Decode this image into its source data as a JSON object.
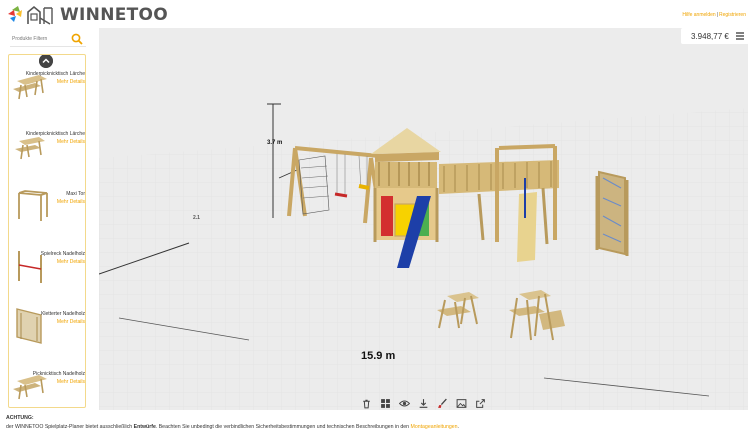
{
  "header": {
    "brand": "WINNETOO",
    "help_link": "Hilfe anmelden",
    "register_link": "Registrieren"
  },
  "sidebar": {
    "filter_placeholder": "Produkte Filtern",
    "products": [
      {
        "name": "Kinderpicknicktisch Lärche",
        "more": "Mehr Details"
      },
      {
        "name": "Kinderpicknicktisch Lärche",
        "more": "Mehr Details"
      },
      {
        "name": "Maxi Tor",
        "more": "Mehr Details"
      },
      {
        "name": "Spielreck Nadelholz",
        "more": "Mehr Details"
      },
      {
        "name": "Kletterter Nadelholz",
        "more": "Mehr Details"
      },
      {
        "name": "Picknicktisch Nadelholz",
        "more": "Mehr Details"
      }
    ]
  },
  "canvas": {
    "price": "3.948,77 €",
    "height_label": "3.7 m",
    "width_label": "15.9 m",
    "small_label": "2.1"
  },
  "toolbar": {
    "icons": [
      "trash-icon",
      "grid-icon",
      "eye-icon",
      "download-icon",
      "brush-icon",
      "image-icon",
      "external-link-icon"
    ]
  },
  "footer": {
    "heading": "ACHTUNG:",
    "text_before": "der WINNETOO Spielplatz-Planer bietet ausschließlich",
    "bold": "Entwürfe",
    "text_after": ". Beachten Sie unbedingt die verbindlichen Sicherheitsbestimmungen und technischen Beschreibungen in den",
    "link": "Montageanleitungen",
    "end": "."
  },
  "colors": {
    "accent": "#f0a400",
    "canvas_bg": "#ececec",
    "slide_blue": "#1d3fa8"
  }
}
